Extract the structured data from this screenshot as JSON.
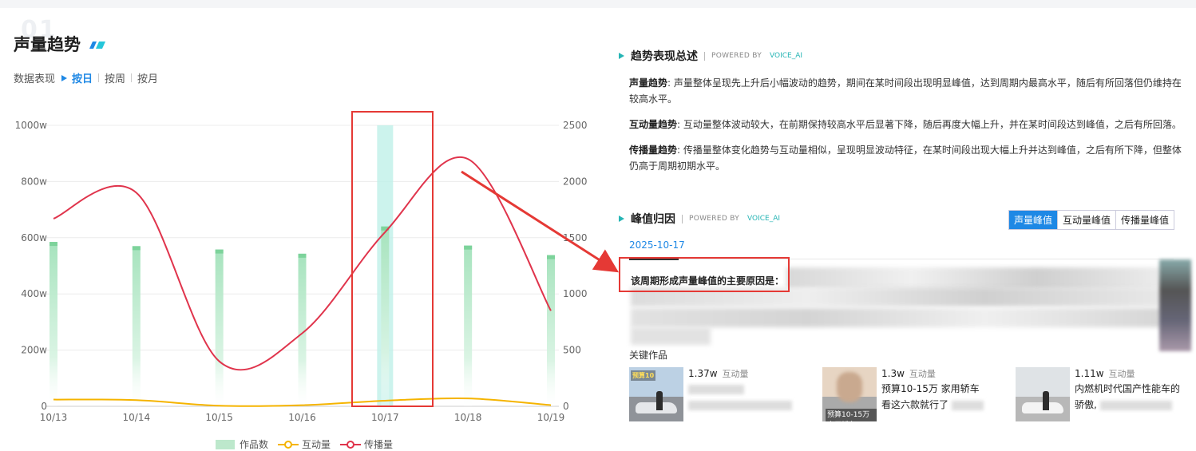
{
  "section": {
    "number": "01",
    "title": "声量趋势"
  },
  "tabs": {
    "label": "数据表现",
    "items": [
      "按日",
      "按周",
      "按月"
    ],
    "active": 0
  },
  "chart_data": {
    "type": "bar+line",
    "categories": [
      "10/13",
      "10/14",
      "10/15",
      "10/16",
      "10/17",
      "10/18",
      "10/19"
    ],
    "left_axis": {
      "ticks": [
        "1000w",
        "800w",
        "600w",
        "400w",
        "200w",
        "0"
      ],
      "range": [
        0,
        1000
      ]
    },
    "right_axis": {
      "ticks": [
        "2500",
        "2000",
        "1500",
        "1000",
        "500",
        "0"
      ],
      "range": [
        0,
        2500
      ]
    },
    "series": [
      {
        "name": "作品数",
        "kind": "bar",
        "axis": "left",
        "values": [
          585,
          570,
          558,
          543,
          640,
          572,
          538
        ],
        "color": "#8fd9a8"
      },
      {
        "name": "互动量",
        "kind": "line",
        "axis": "right",
        "values": [
          60,
          55,
          5,
          10,
          50,
          70,
          10
        ],
        "color": "#f5b400"
      },
      {
        "name": "传播量",
        "kind": "line",
        "axis": "right",
        "values": [
          1670,
          1900,
          400,
          650,
          1550,
          2200,
          850
        ],
        "color": "#e0344c"
      }
    ]
  },
  "summary": {
    "title": "趋势表现总述",
    "powered": "POWERED BY",
    "brand": "VOICE_AI",
    "paragraphs": [
      {
        "label": "声量趋势",
        "text": ": 声量整体呈现先上升后小幅波动的趋势，期间在某时间段出现明显峰值，达到周期内最高水平，随后有所回落但仍维持在较高水平。"
      },
      {
        "label": "互动量趋势",
        "text": ": 互动量整体波动较大，在前期保持较高水平后显著下降，随后再度大幅上升，并在某时间段达到峰值，之后有所回落。"
      },
      {
        "label": "传播量趋势",
        "text": ": 传播量整体变化趋势与互动量相似，呈现明显波动特征，在某时间段出现大幅上升并达到峰值，之后有所下降，但整体仍高于周期初期水平。"
      }
    ]
  },
  "peak": {
    "title": "峰值归因",
    "powered": "POWERED BY",
    "brand": "VOICE_AI",
    "tabs": [
      "声量峰值",
      "互动量峰值",
      "传播量峰值"
    ],
    "active": 0,
    "date": "2025-10-17",
    "reason_label": "该周期形成声量峰值的主要原因是：",
    "key_works_title": "关键作品",
    "works": [
      {
        "count": "1.37w",
        "label": "互动量",
        "caption": "预算10"
      },
      {
        "count": "1.3w",
        "label": "互动量",
        "line1": "预算10-15万 家用轿车",
        "line2": "看这六款就行了",
        "caption": "预算10-15万 家用轿车"
      },
      {
        "count": "1.11w",
        "label": "互动量",
        "line1": "内燃机时代国产性能车的",
        "line2": "骄傲,"
      }
    ]
  }
}
